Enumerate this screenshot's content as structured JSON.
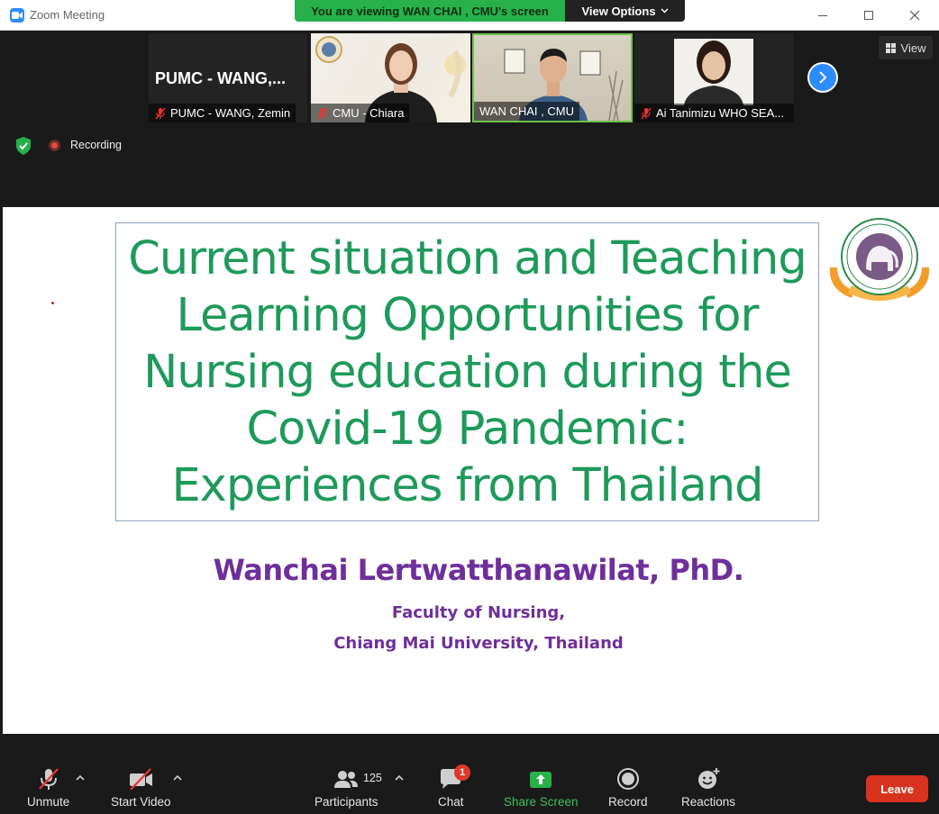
{
  "window": {
    "title": "Zoom Meeting"
  },
  "share_banner": {
    "text": "You are viewing WAN CHAI , CMU's screen",
    "view_options_label": "View Options"
  },
  "participants_strip": {
    "tiles": [
      {
        "display_name": "PUMC  -  WANG,...",
        "name": "PUMC - WANG, Zemin",
        "muted": true,
        "video": false
      },
      {
        "name": "CMU - Chiara",
        "muted": true,
        "video": true
      },
      {
        "name": "WAN CHAI , CMU",
        "muted": false,
        "video": true,
        "active_speaker": true
      },
      {
        "name": "Ai Tanimizu WHO SEA...",
        "muted": true,
        "video": true
      }
    ],
    "view_label": "View"
  },
  "recording": {
    "label": "Recording"
  },
  "slide": {
    "title": "Current situation and Teaching Learning Opportunities for Nursing education during the Covid-19 Pandemic: Experiences from Thailand",
    "author": "Wanchai Lertwatthanawilat, PhD.",
    "affiliation_line1": "Faculty of Nursing,",
    "affiliation_line2": "Chiang Mai University, Thailand",
    "title_color": "#1e9a5a",
    "author_color": "#6f2f9a"
  },
  "toolbar": {
    "unmute_label": "Unmute",
    "start_video_label": "Start Video",
    "participants_label": "Participants",
    "participants_count": "125",
    "chat_label": "Chat",
    "chat_badge": "1",
    "share_screen_label": "Share Screen",
    "record_label": "Record",
    "reactions_label": "Reactions",
    "leave_label": "Leave",
    "share_color": "#3ec15f",
    "leave_color": "#d8331f"
  }
}
